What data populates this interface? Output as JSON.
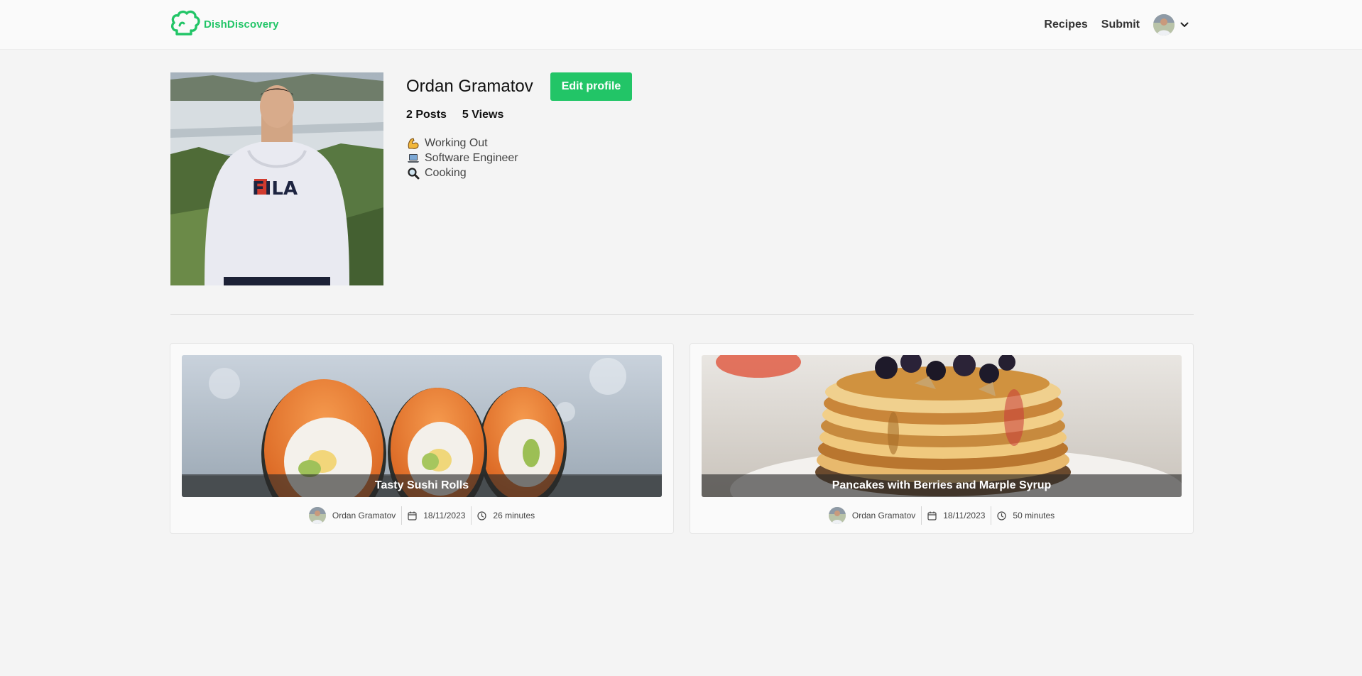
{
  "brand": {
    "name": "DishDiscovery",
    "color": "#22c567"
  },
  "nav": {
    "links": [
      "Recipes",
      "Submit"
    ],
    "avatar_icon": "user-avatar",
    "menu_icon": "chevron-down-icon"
  },
  "profile": {
    "name": "Ordan Gramatov",
    "edit_button": "Edit profile",
    "posts": "2 Posts",
    "views": "5 Views",
    "interests": [
      {
        "icon": "flexed-biceps-emoji",
        "label": "Working Out"
      },
      {
        "icon": "laptop-emoji",
        "label": "Software Engineer"
      },
      {
        "icon": "magnifying-glass-emoji",
        "label": "Cooking"
      }
    ]
  },
  "recipes": [
    {
      "title": "Tasty Sushi Rolls",
      "author": "Ordan Gramatov",
      "date": "18/11/2023",
      "time": "26 minutes"
    },
    {
      "title": "Pancakes with Berries and Marple Syrup",
      "author": "Ordan Gramatov",
      "date": "18/11/2023",
      "time": "50 minutes"
    }
  ]
}
